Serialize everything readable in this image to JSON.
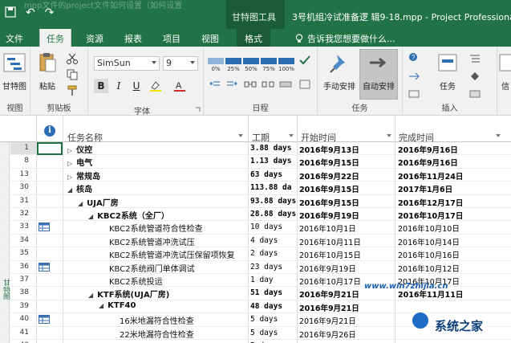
{
  "titlebar": {
    "context_tool": "甘特图工具",
    "title": "3号机组冷试准备逻 辑9-18.mpp - Project Professional",
    "overlay_text": "mpp文件的project文件如何设置（如何设置",
    "undo": "↶",
    "redo": "↷"
  },
  "tabs": {
    "file": "文件",
    "task": "任务",
    "resource": "资源",
    "report": "报表",
    "project": "项目",
    "view": "视图",
    "format": "格式",
    "tell_me": "告诉我您想要做什么..."
  },
  "ribbon": {
    "gantt_label": "甘特图",
    "view_group": "视图",
    "paste_label": "粘贴",
    "clipboard_group": "剪贴板",
    "font_name": "SimSun",
    "font_size": "9",
    "bold": "B",
    "italic": "I",
    "underline": "U",
    "font_group": "字体",
    "pct_labels": [
      "0%",
      "25%",
      "50%",
      "75%",
      "100%"
    ],
    "schedule_group": "日程",
    "manual_label": "手动安排",
    "auto_label": "自动安排",
    "tasks_group": "任务",
    "task_label": "任务",
    "insert_group": "插入",
    "info_label": "信"
  },
  "grid": {
    "info_col": "i",
    "columns": {
      "name": "任务名称",
      "duration": "工期",
      "start": "开始时间",
      "finish": "完成时间"
    },
    "side_label": "甘特图",
    "rows": [
      {
        "id": "1",
        "name": "仪控",
        "level": 0,
        "collapsed": true,
        "summary": true,
        "dur": "3.88 days",
        "start": "2016年9月13日",
        "finish": "2016年9月16日",
        "indicator": ""
      },
      {
        "id": "8",
        "name": "电气",
        "level": 0,
        "collapsed": true,
        "summary": true,
        "dur": "1.13 days",
        "start": "2016年9月15日",
        "finish": "2016年9月16日",
        "indicator": ""
      },
      {
        "id": "13",
        "name": "常规岛",
        "level": 0,
        "collapsed": true,
        "summary": true,
        "dur": "63 days",
        "start": "2016年9月22日",
        "finish": "2016年11月24日",
        "indicator": ""
      },
      {
        "id": "30",
        "name": "核岛",
        "level": 0,
        "collapsed": false,
        "summary": true,
        "dur": "113.88 da",
        "start": "2016年9月15日",
        "finish": "2017年1月6日",
        "indicator": ""
      },
      {
        "id": "31",
        "name": "UJA厂房",
        "level": 1,
        "collapsed": false,
        "summary": true,
        "dur": "93.88 days",
        "start": "2016年9月15日",
        "finish": "2016年12月17日",
        "indicator": ""
      },
      {
        "id": "32",
        "name": "KBC2系统（全厂）",
        "level": 2,
        "collapsed": false,
        "summary": true,
        "dur": "28.88 days",
        "start": "2016年9月19日",
        "finish": "2016年10月17日",
        "indicator": ""
      },
      {
        "id": "33",
        "name": "KBC2系统管道符合性检查",
        "level": 3,
        "collapsed": false,
        "summary": false,
        "dur": "10 days",
        "start": "2016年10月1日",
        "finish": "2016年10月10日",
        "indicator": "table"
      },
      {
        "id": "34",
        "name": "KBC2系统管道冲洗试压",
        "level": 3,
        "collapsed": false,
        "summary": false,
        "dur": "4 days",
        "start": "2016年10月11日",
        "finish": "2016年10月14日",
        "indicator": ""
      },
      {
        "id": "35",
        "name": "KBC2系统管道冲洗试压保留项恢复",
        "level": 3,
        "collapsed": false,
        "summary": false,
        "dur": "2 days",
        "start": "2016年10月15日",
        "finish": "2016年10月16日",
        "indicator": ""
      },
      {
        "id": "36",
        "name": "KBC2系统阀门单体调试",
        "level": 3,
        "collapsed": false,
        "summary": false,
        "dur": "23 days",
        "start": "2016年9月19日",
        "finish": "2016年10月12日",
        "indicator": "table"
      },
      {
        "id": "37",
        "name": "KBC2系统投运",
        "level": 3,
        "collapsed": false,
        "summary": false,
        "dur": "1 day",
        "start": "2016年10月17日",
        "finish": "2016年10月17日",
        "indicator": ""
      },
      {
        "id": "38",
        "name": "KTF系统(UJA厂房)",
        "level": 2,
        "collapsed": false,
        "summary": true,
        "dur": "51 days",
        "start": "2016年9月21日",
        "finish": "2016年11月11日",
        "indicator": ""
      },
      {
        "id": "39",
        "name": "KTF40",
        "level": 3,
        "collapsed": false,
        "summary": true,
        "dur": "48 days",
        "start": "2016年9月21日",
        "finish": "",
        "indicator": ""
      },
      {
        "id": "40",
        "name": "16米地漏符合性检查",
        "level": 4,
        "collapsed": false,
        "summary": false,
        "dur": "5 days",
        "start": "2016年9月21日",
        "finish": "",
        "indicator": "table"
      },
      {
        "id": "41",
        "name": "22米地漏符合性检查",
        "level": 4,
        "collapsed": false,
        "summary": false,
        "dur": "5 days",
        "start": "2016年9月26日",
        "finish": "",
        "indicator": ""
      },
      {
        "id": "42",
        "name": "24米地漏符合性检查",
        "level": 4,
        "collapsed": false,
        "summary": false,
        "dur": "5 days",
        "start": "2016年9月...",
        "finish": "",
        "indicator": ""
      }
    ]
  },
  "watermark": {
    "url": "www.win7zhijia.cn",
    "brand": "系统之家"
  },
  "colors": {
    "accent": "#217346",
    "info_blue": "#2a6cb6"
  }
}
